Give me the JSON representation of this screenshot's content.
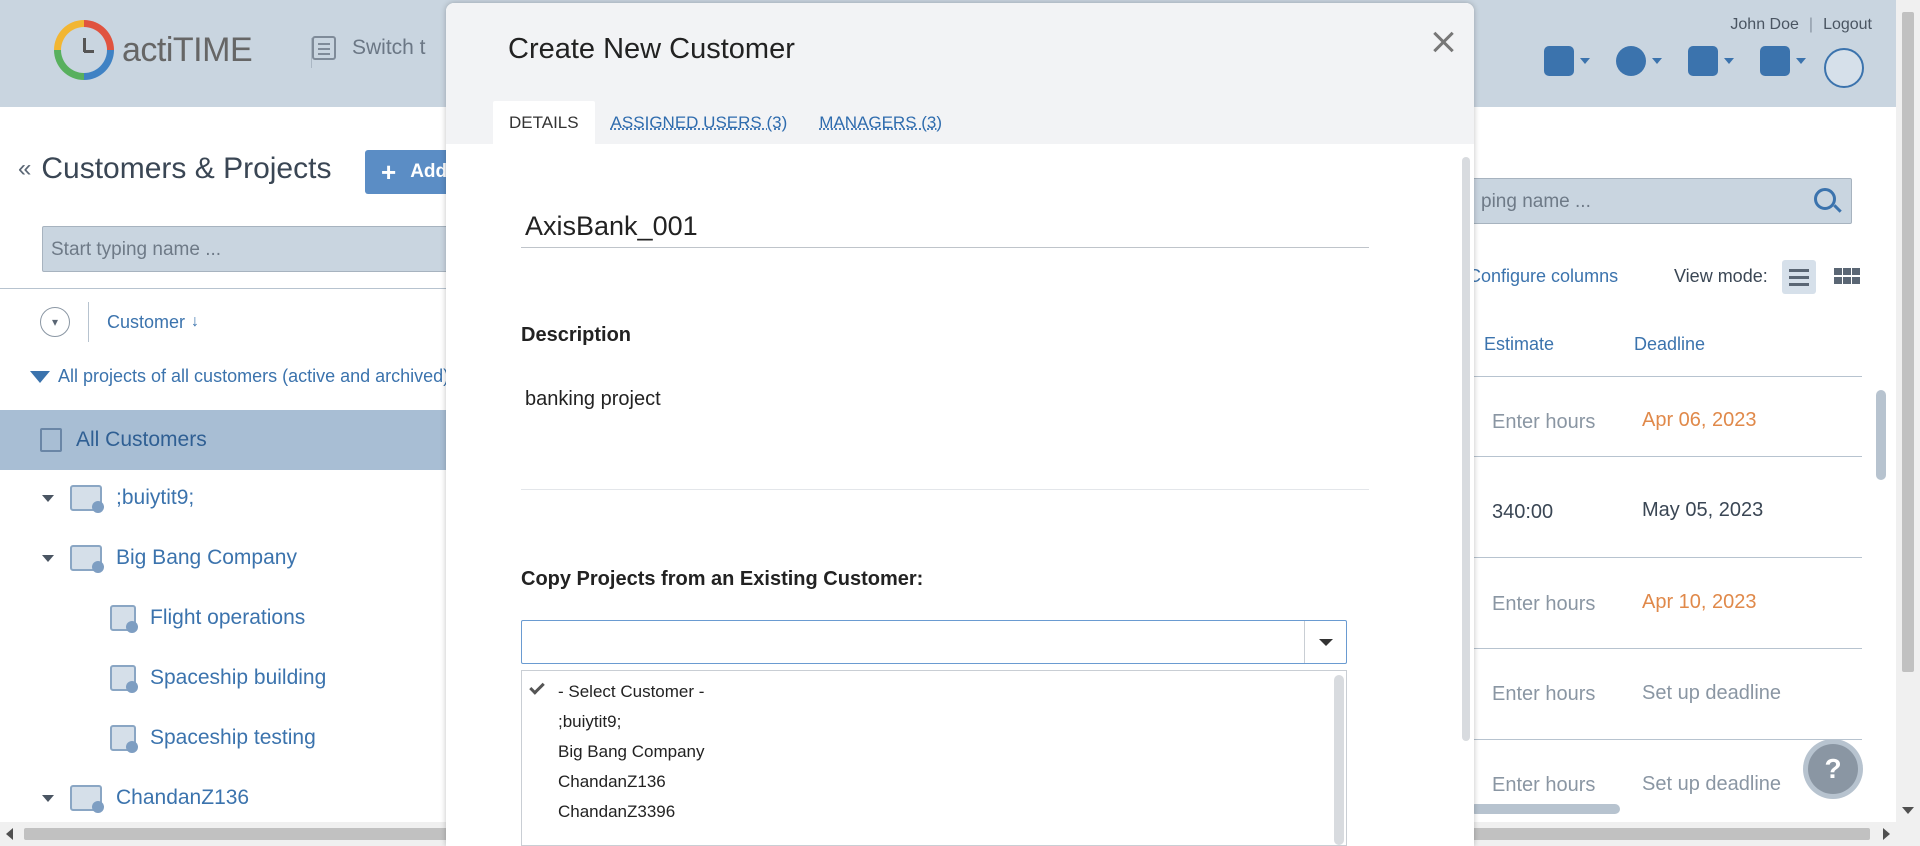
{
  "app": {
    "logo_text": "actiTIME",
    "switch_label": "Switch t",
    "user_name": "John Doe",
    "user_sep": "|",
    "logout_label": "Logout"
  },
  "left_panel": {
    "page_title": "Customers & Projects",
    "add_label": "Add",
    "search_placeholder": "Start typing name ...",
    "sort_label": "Customer",
    "sort_arrow": "↓",
    "filter_text": "All projects of all customers (active and archived)",
    "all_customers_label": "All Customers",
    "tree": [
      {
        "label": ";buiytit9;",
        "level": 0
      },
      {
        "label": "Big Bang Company",
        "level": 0
      },
      {
        "label": "Flight operations",
        "level": 1
      },
      {
        "label": "Spaceship building",
        "level": 1
      },
      {
        "label": "Spaceship testing",
        "level": 1
      },
      {
        "label": "ChandanZ136",
        "level": 0
      }
    ]
  },
  "right_panel": {
    "search_placeholder": "ping name ...",
    "configure_columns": "Configure columns",
    "view_mode_label": "View mode:",
    "columns": [
      "Estimate",
      "Deadline"
    ],
    "rows": [
      {
        "estimate": "Enter hours",
        "deadline": "Apr 06, 2023",
        "deadline_style": "orange"
      },
      {
        "estimate": "340:00",
        "deadline": "May 05, 2023",
        "deadline_style": "dark"
      },
      {
        "estimate": "Enter hours",
        "deadline": "Apr 10, 2023",
        "deadline_style": "orange"
      },
      {
        "estimate": "Enter hours",
        "deadline": "Set up deadline",
        "deadline_style": "muted"
      },
      {
        "estimate": "Enter hours",
        "deadline": "Set up deadline",
        "deadline_style": "muted"
      }
    ],
    "help_fab": "?"
  },
  "modal": {
    "title": "Create New Customer",
    "tabs": [
      {
        "label": "DETAILS",
        "active": true
      },
      {
        "label": "ASSIGNED USERS (3)",
        "active": false
      },
      {
        "label": "MANAGERS (3)",
        "active": false
      }
    ],
    "customer_name": "AxisBank_001",
    "description_label": "Description",
    "description_value": "banking project",
    "copy_label": "Copy Projects from an Existing Customer:",
    "select_value": "",
    "options": [
      {
        "label": "- Select Customer -",
        "selected": true
      },
      {
        "label": ";buiytit9;",
        "selected": false
      },
      {
        "label": "Big Bang Company",
        "selected": false
      },
      {
        "label": "ChandanZ136",
        "selected": false
      },
      {
        "label": "ChandanZ3396",
        "selected": false
      }
    ]
  },
  "colors": {
    "accent": "#3b73ad",
    "overlay_bg": "#c9d5e0",
    "orange": "#e0894a"
  }
}
